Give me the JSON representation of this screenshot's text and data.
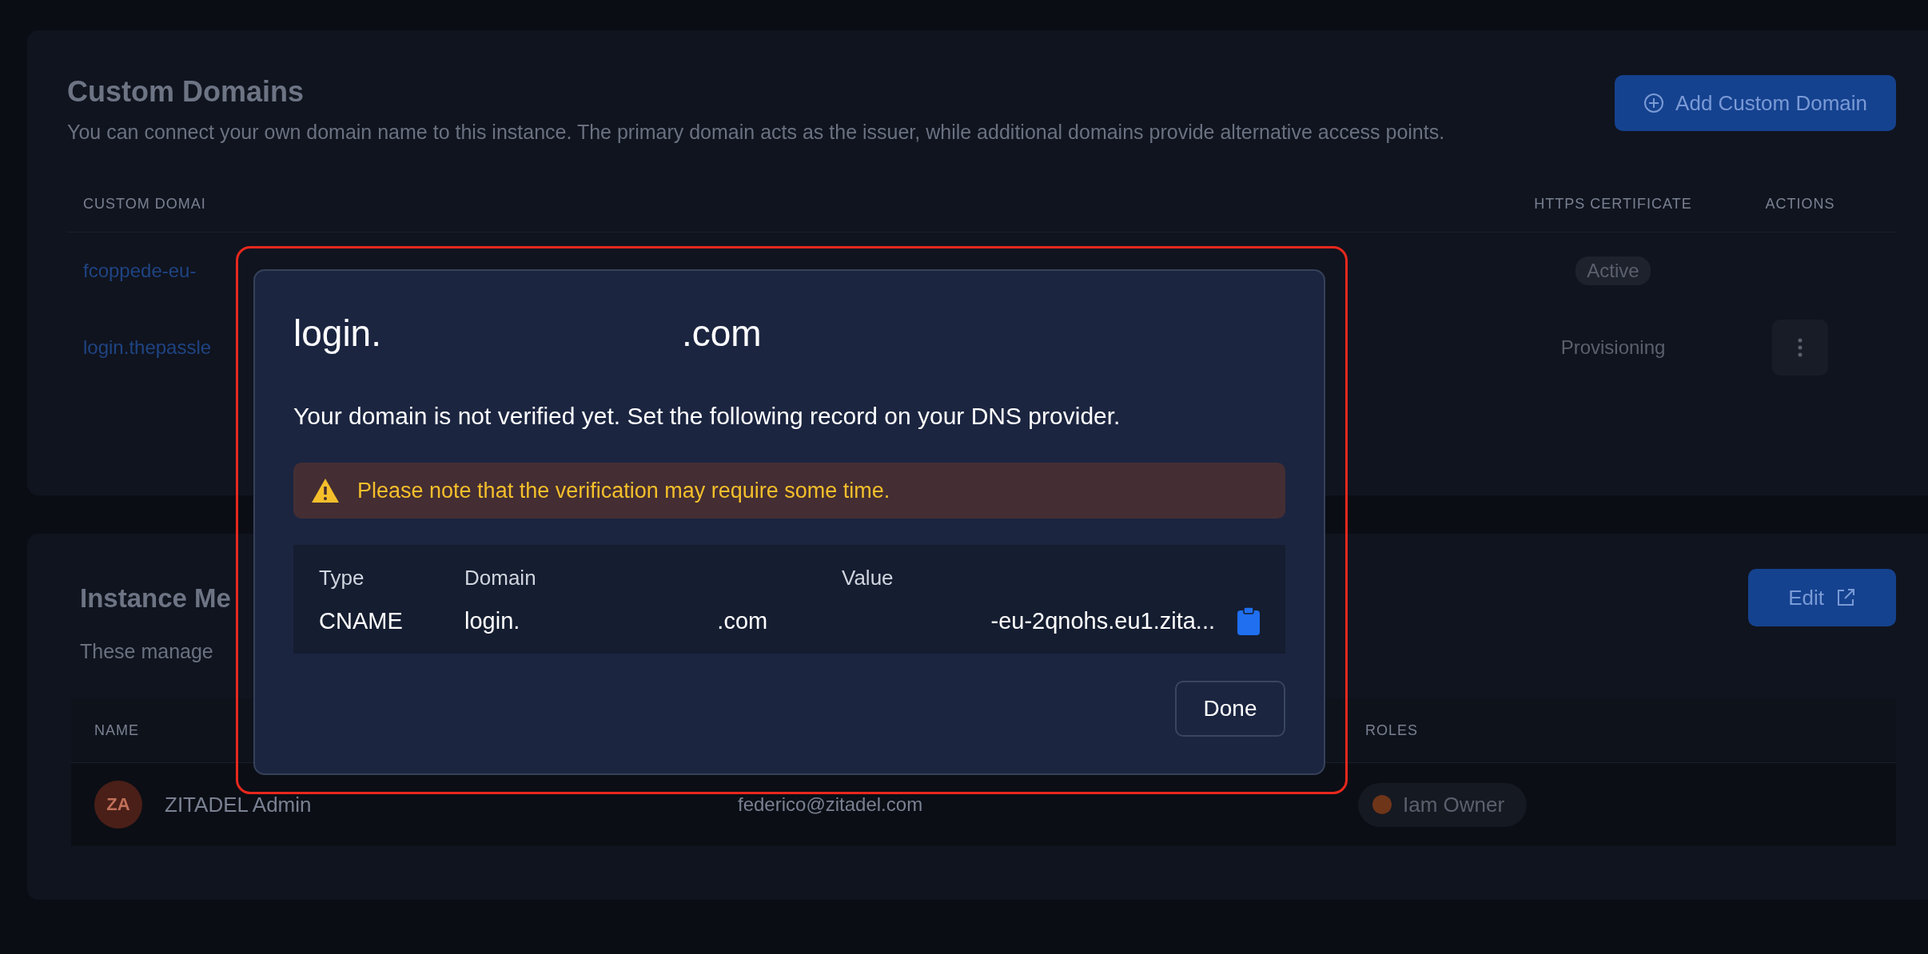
{
  "custom_domains": {
    "title": "Custom Domains",
    "description": "You can connect your own domain name to this instance. The primary domain acts as the issuer, while additional domains provide alternative access points.",
    "add_button": "Add Custom Domain",
    "columns": [
      {
        "label": "CUSTOM DOMAI"
      },
      {
        "label": "HTTPS CERTIFICATE"
      },
      {
        "label": "ACTIONS"
      }
    ],
    "rows": [
      {
        "domain": "fcoppede-eu-",
        "certificate": "Active",
        "kind": "badge",
        "has_menu": false
      },
      {
        "domain": "login.thepassle",
        "certificate": "Provisioning",
        "kind": "plain",
        "has_menu": true
      }
    ]
  },
  "managers": {
    "title": "Instance Me",
    "description": "These manage",
    "edit_button": "Edit",
    "columns": [
      {
        "label": "NAME"
      },
      {
        "label": "ROLES"
      }
    ],
    "rows": [
      {
        "initials": "ZA",
        "name": "ZITADEL Admin",
        "email": "federico@zitadel.com",
        "role": "Iam Owner"
      }
    ]
  },
  "dialog": {
    "title": {
      "prefix": "login.",
      "suffix": ".com"
    },
    "message": "Your domain is not verified yet. Set the following record on your DNS provider.",
    "warning": "Please note that the verification may require some time.",
    "record": {
      "headers": [
        "Type",
        "Domain",
        "Value"
      ],
      "type": "CNAME",
      "domain": {
        "prefix": "login.",
        "suffix": ".com"
      },
      "value": "-eu-2qnohs.eu1.zita..."
    },
    "done_button": "Done"
  }
}
